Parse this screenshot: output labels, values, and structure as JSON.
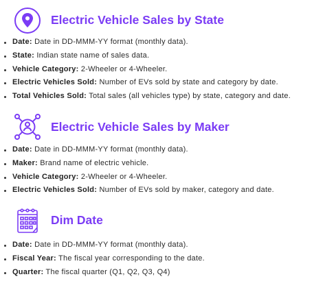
{
  "sections": [
    {
      "title": "Electric Vehicle Sales by State",
      "icon": "location-pin-icon",
      "items": [
        {
          "label": "Date:",
          "text": " Date in DD-MMM-YY format (monthly data)."
        },
        {
          "label": "State:",
          "text": " Indian state name of sales data."
        },
        {
          "label": "Vehicle Category:",
          "text": " 2-Wheeler or 4-Wheeler."
        },
        {
          "label": "Electric Vehicles Sold:",
          "text": " Number of EVs sold by state and category by date."
        },
        {
          "label": "Total Vehicles Sold:",
          "text": " Total sales (all vehicles type) by state, category and date."
        }
      ]
    },
    {
      "title": "Electric Vehicle Sales by Maker",
      "icon": "user-network-icon",
      "items": [
        {
          "label": "Date:",
          "text": " Date in DD-MMM-YY format (monthly data)."
        },
        {
          "label": "Maker:",
          "text": " Brand name of electric vehicle."
        },
        {
          "label": "Vehicle Category:",
          "text": " 2-Wheeler or 4-Wheeler."
        },
        {
          "label": "Electric Vehicles Sold:",
          "text": " Number of EVs sold by maker, category and date."
        }
      ]
    },
    {
      "title": "Dim Date",
      "icon": "calendar-icon",
      "items": [
        {
          "label": "Date:",
          "text": " Date in DD-MMM-YY format (monthly data)."
        },
        {
          "label": "Fiscal Year:",
          "text": " The fiscal year corresponding to the date."
        },
        {
          "label": "Quarter:",
          "text": " The fiscal quarter (Q1, Q2, Q3, Q4)"
        }
      ]
    }
  ],
  "colors": {
    "accent": "#7b3cf5",
    "text": "#2a2a2a"
  }
}
